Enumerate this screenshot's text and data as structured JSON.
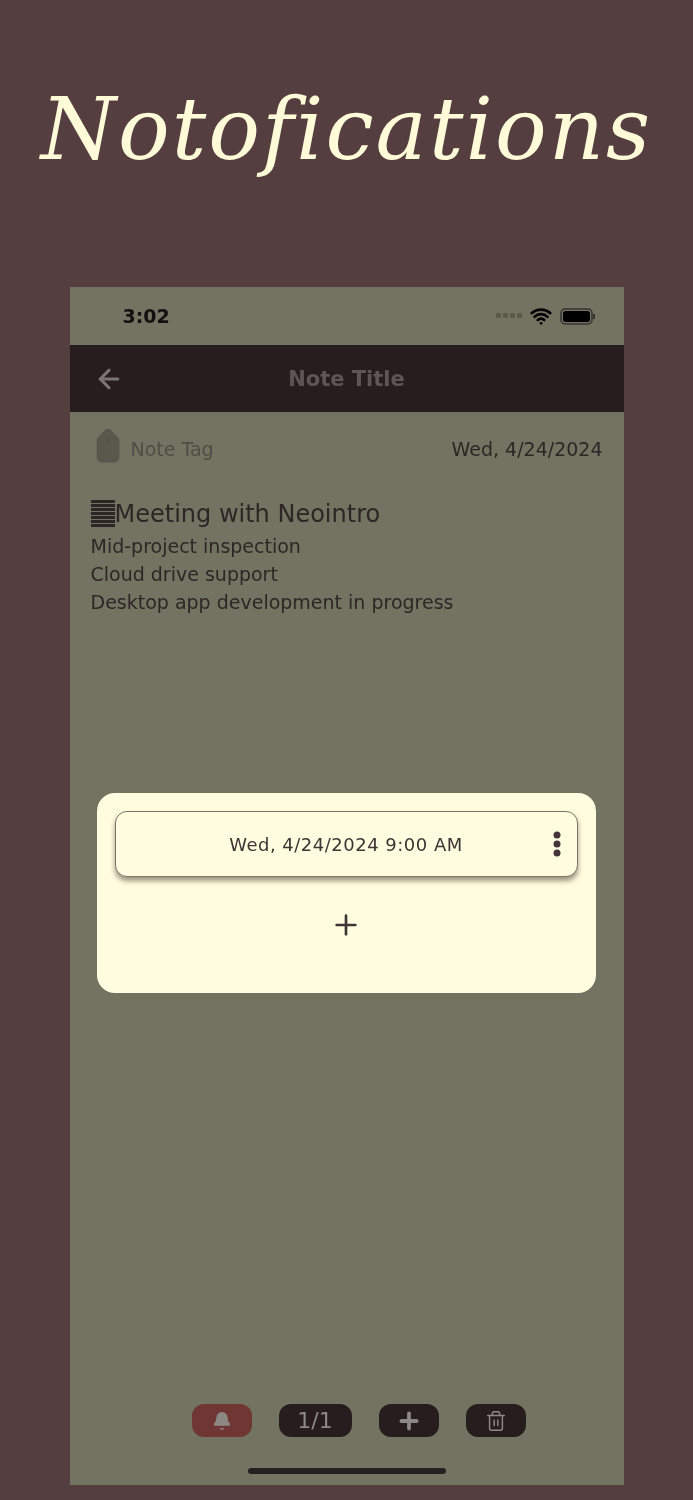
{
  "headline": "Notofications",
  "status_bar": {
    "time": "3:02"
  },
  "nav_bar": {
    "title": "Note Title"
  },
  "note": {
    "tag": "Note Tag",
    "date": "Wed, 4/24/2024",
    "heading": "Meeting with Neointro",
    "lines": [
      "Mid-project inspection",
      "Cloud drive support",
      "Desktop app development in progress"
    ]
  },
  "reminders_dialog": {
    "reminders": [
      {
        "datetime": "Wed, 4/24/2024 9:00 AM"
      }
    ]
  },
  "toolbar": [
    {
      "kind": "bell",
      "on": true
    },
    {
      "kind": "counter",
      "label": "1/1"
    },
    {
      "kind": "add"
    },
    {
      "kind": "delete"
    }
  ]
}
